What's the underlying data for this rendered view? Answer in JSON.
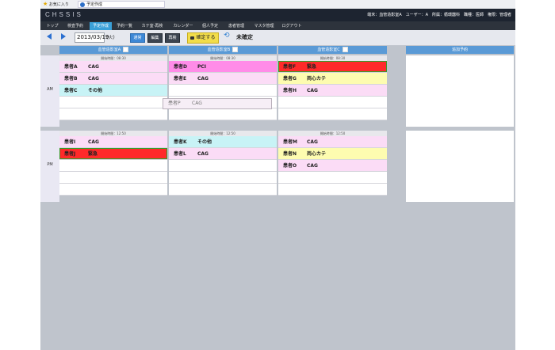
{
  "browser": {
    "favorites": "お気に入り",
    "tab": "予定作成"
  },
  "header": {
    "logo": "CHSSIS",
    "user_info": "端末：血管造影室A　ユーザー：A　所属：循環器科　職種：医師　権限：管理者"
  },
  "nav": {
    "tabs": [
      {
        "label": "トップ"
      },
      {
        "label": "検査予約"
      },
      {
        "label": "予定作成",
        "active": true
      },
      {
        "label": "予約一覧"
      },
      {
        "label": "カテ室-再検"
      },
      {
        "label": "カレンダー"
      },
      {
        "label": "個人予定"
      },
      {
        "label": "患者管理"
      },
      {
        "label": "マスタ管理"
      },
      {
        "label": "ログアウト"
      }
    ]
  },
  "toolbar": {
    "date": "2013/03/19",
    "dow": "(火)",
    "mode_buttons": [
      "通常",
      "編集",
      "再検"
    ],
    "confirm_label": "確定する",
    "status": "未確定"
  },
  "rooms": [
    "血管造影室A",
    "血管造影室B",
    "血管造影室C"
  ],
  "side_header": "追加予約",
  "am_label": "AM",
  "pm_label": "PM",
  "am_start": "開始時間：08:30",
  "pm_start": "開始時間：12:50",
  "colors": {
    "pink": "#fbdcf6",
    "magenta": "#ff8ce8",
    "cyan": "#c8f3f6",
    "red": "#ff2a2a",
    "yellow": "#fdfcb0",
    "empty": "#ffffff"
  },
  "am": [
    [
      {
        "patient": "患者A",
        "proc": "CAG",
        "color": "pink"
      },
      {
        "patient": "患者B",
        "proc": "CAG",
        "color": "pink"
      },
      {
        "patient": "患者C",
        "proc": "その他",
        "color": "cyan"
      },
      {
        "patient": "",
        "proc": "",
        "color": "empty"
      },
      {
        "patient": "",
        "proc": "",
        "color": "empty"
      }
    ],
    [
      {
        "patient": "患者D",
        "proc": "PCI",
        "color": "magenta"
      },
      {
        "patient": "患者E",
        "proc": "CAG",
        "color": "pink"
      },
      {
        "patient": "",
        "proc": "",
        "color": "empty"
      },
      {
        "patient": "",
        "proc": "",
        "color": "empty"
      },
      {
        "patient": "",
        "proc": "",
        "color": "empty"
      }
    ],
    [
      {
        "patient": "患者F",
        "proc": "緊急",
        "color": "red"
      },
      {
        "patient": "患者G",
        "proc": "両心カテ",
        "color": "yellow"
      },
      {
        "patient": "患者H",
        "proc": "CAG",
        "color": "pink"
      },
      {
        "patient": "",
        "proc": "",
        "color": "empty"
      },
      {
        "patient": "",
        "proc": "",
        "color": "empty"
      }
    ]
  ],
  "pm": [
    [
      {
        "patient": "患者I",
        "proc": "CAG",
        "color": "pink"
      },
      {
        "patient": "患者J",
        "proc": "緊急",
        "color": "red"
      },
      {
        "patient": "",
        "proc": "",
        "color": "empty"
      },
      {
        "patient": "",
        "proc": "",
        "color": "empty"
      },
      {
        "patient": "",
        "proc": "",
        "color": "empty"
      }
    ],
    [
      {
        "patient": "患者K",
        "proc": "その他",
        "color": "cyan"
      },
      {
        "patient": "患者L",
        "proc": "CAG",
        "color": "pink"
      },
      {
        "patient": "",
        "proc": "",
        "color": "empty"
      },
      {
        "patient": "",
        "proc": "",
        "color": "empty"
      },
      {
        "patient": "",
        "proc": "",
        "color": "empty"
      }
    ],
    [
      {
        "patient": "患者M",
        "proc": "CAG",
        "color": "pink"
      },
      {
        "patient": "患者N",
        "proc": "両心カテ",
        "color": "yellow"
      },
      {
        "patient": "患者O",
        "proc": "CAG",
        "color": "pink"
      },
      {
        "patient": "",
        "proc": "",
        "color": "empty"
      },
      {
        "patient": "",
        "proc": "",
        "color": "empty"
      }
    ]
  ],
  "dragging": {
    "patient": "患者P",
    "proc": "CAG"
  }
}
